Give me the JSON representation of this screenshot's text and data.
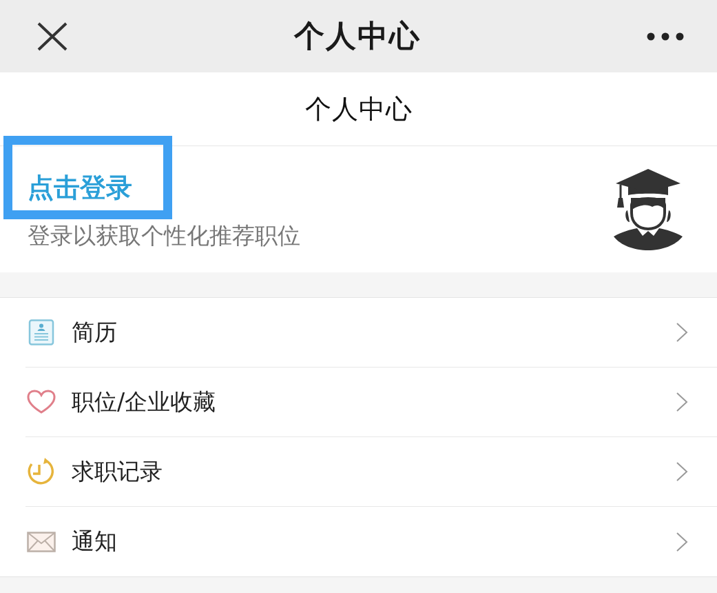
{
  "top_bar": {
    "title": "个人中心"
  },
  "page_header": {
    "title": "个人中心"
  },
  "profile": {
    "login_label": "点击登录",
    "highlighted": true,
    "subtitle": "登录以获取个性化推荐职位"
  },
  "menu": [
    {
      "kind": "resume",
      "label": "简历"
    },
    {
      "kind": "favorite",
      "label": "职位/企业收藏"
    },
    {
      "kind": "history",
      "label": "求职记录"
    },
    {
      "kind": "notice",
      "label": "通知"
    }
  ]
}
